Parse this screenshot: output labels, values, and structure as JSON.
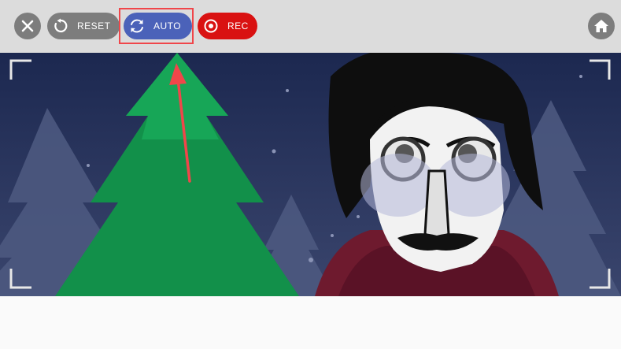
{
  "toolbar": {
    "close_icon": "close-icon",
    "reset": {
      "label": "RESET",
      "icon": "reset-icon"
    },
    "auto": {
      "label": "AUTO",
      "icon": "sync-icon"
    },
    "rec": {
      "label": "REC",
      "icon": "record-icon"
    },
    "home_icon": "home-icon"
  },
  "colors": {
    "toolbar_bg": "#dcdcdc",
    "neutral_button": "#7d7d7d",
    "auto_button": "#4b62b9",
    "rec_button": "#d91111",
    "highlight": "#f0464a",
    "scene_bg": "#1a2547",
    "tree": "#12904a",
    "character_scarf": "#6e1a2e"
  },
  "stage": {
    "scene": "winter-night-character-with-christmas-tree",
    "frame_corners": "viewfinder-brackets"
  }
}
